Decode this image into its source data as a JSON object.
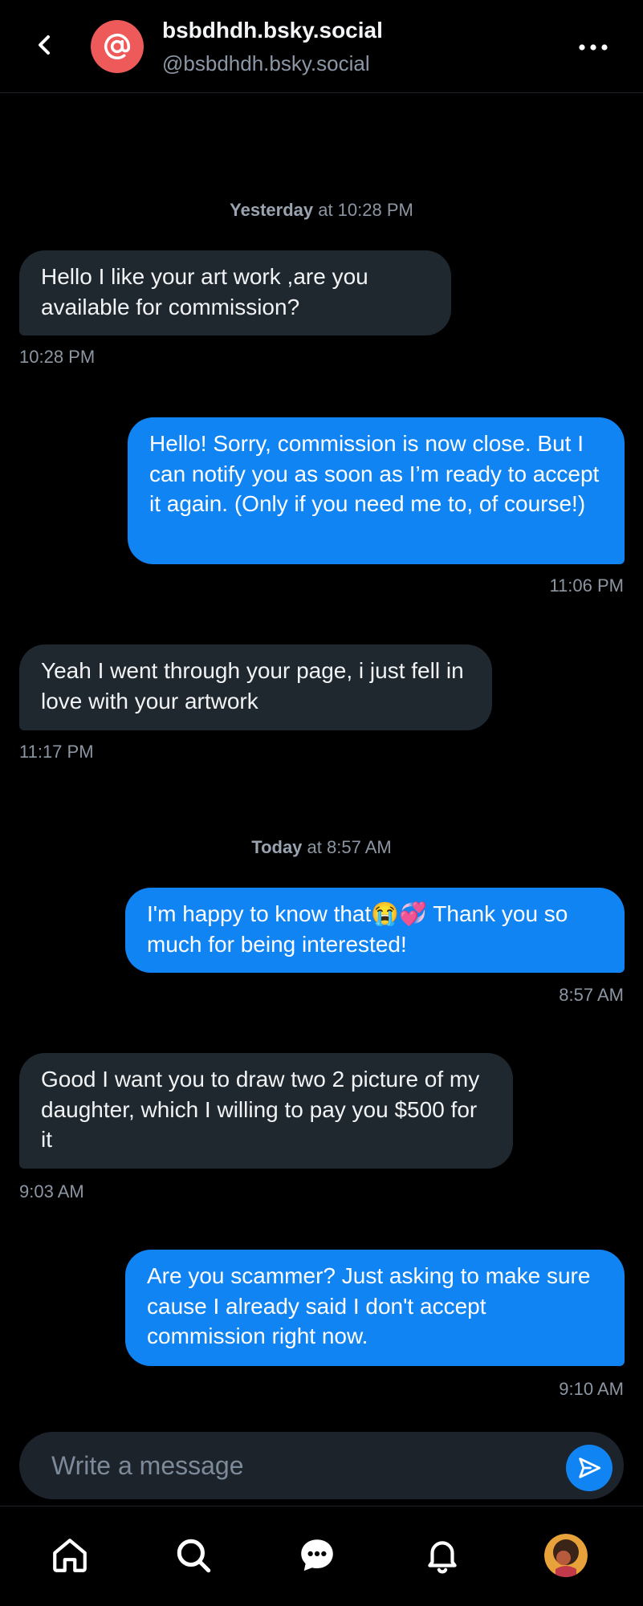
{
  "header": {
    "display_name": "bsbdhdh.bsky.social",
    "handle": "@bsbdhdh.bsky.social",
    "back_icon": "chevron-left-icon",
    "more_icon": "more-horizontal-icon",
    "avatar_icon": "at-sign-icon"
  },
  "dates": [
    {
      "day": "Yesterday",
      "rest": " at 10:28 PM"
    },
    {
      "day": "Today",
      "rest": " at 8:57 AM"
    }
  ],
  "messages": [
    {
      "dir": "in",
      "text": "Hello I like your art work ,are you available for commission?",
      "time": "10:28 PM"
    },
    {
      "dir": "out",
      "text": "Hello! Sorry, commission is now close. But I can notify you as soon as I’m ready to accept it again. (Only if you need me to, of course!)",
      "time": "11:06 PM"
    },
    {
      "dir": "in",
      "text": "Yeah I went through your page, i just fell in love with  your artwork",
      "time": "11:17 PM"
    },
    {
      "dir": "out",
      "text": "I'm happy to know that😭💞 Thank you so much for being interested!",
      "time": "8:57 AM"
    },
    {
      "dir": "in",
      "text": "Good I want you to draw two 2 picture of my daughter, which I willing to pay you $500 for it",
      "time": "9:03 AM"
    },
    {
      "dir": "out",
      "text": "Are you scammer? Just asking to make sure cause I already said I don't accept commission right now.",
      "time": "9:10 AM"
    }
  ],
  "composer": {
    "placeholder": "Write a message",
    "send_icon": "send-icon"
  },
  "nav": {
    "items": [
      "home-icon",
      "search-icon",
      "chat-icon",
      "bell-icon",
      "profile-avatar"
    ]
  },
  "colors": {
    "background": "#000000",
    "incoming_bubble": "#1f272f",
    "outgoing_bubble": "#1184f4",
    "avatar": "#ee5a5a",
    "muted_text": "#8c96a3"
  }
}
